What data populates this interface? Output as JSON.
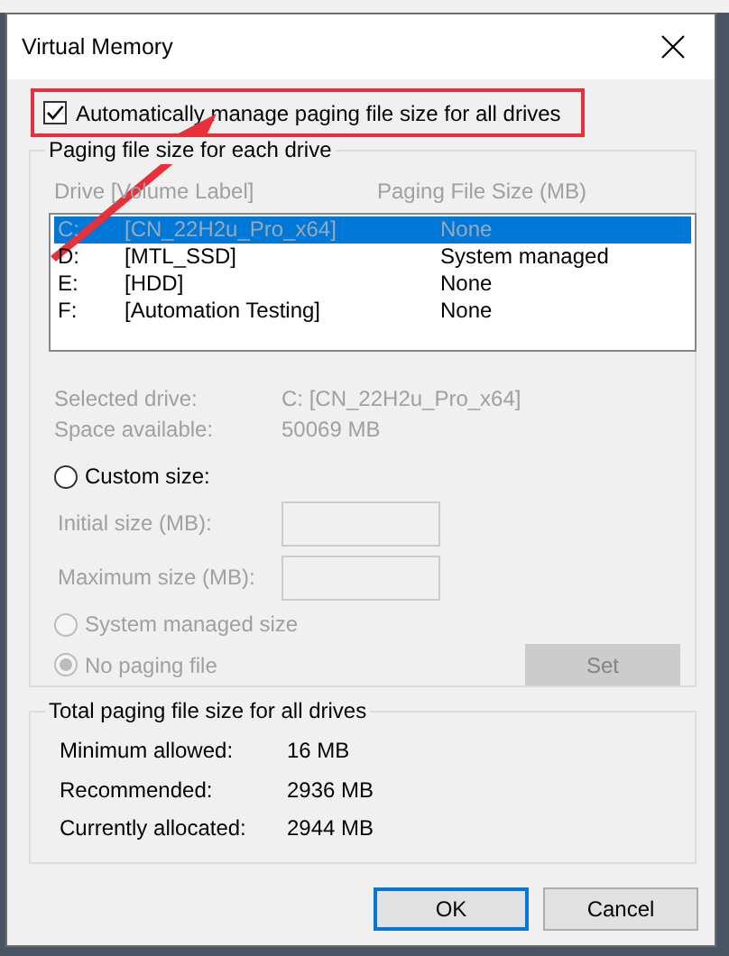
{
  "window": {
    "title": "Virtual Memory"
  },
  "auto_manage": {
    "label": "Automatically manage paging file size for all drives",
    "checked": true
  },
  "drive_group": {
    "legend": "Paging file size for each drive",
    "disabled": true,
    "columns": [
      "Drive  [Volume Label]",
      "Paging File Size (MB)"
    ],
    "drives": [
      {
        "drive": "C:",
        "label": "[CN_22H2u_Pro_x64]",
        "size": "None",
        "selected": true
      },
      {
        "drive": "D:",
        "label": "[MTL_SSD]",
        "size": "System managed",
        "selected": false
      },
      {
        "drive": "E:",
        "label": "[HDD]",
        "size": "None",
        "selected": false
      },
      {
        "drive": "F:",
        "label": "[Automation Testing]",
        "size": "None",
        "selected": false
      }
    ],
    "details": [
      {
        "label": "Selected drive:",
        "value": "C:  [CN_22H2u_Pro_x64]"
      },
      {
        "label": "Space available:",
        "value": "50069 MB"
      }
    ],
    "custom_size": {
      "label": "Custom size:",
      "selected": false,
      "disabled": false
    },
    "size_fields": [
      {
        "label": "Initial size (MB):"
      },
      {
        "label": "Maximum size (MB):"
      }
    ],
    "system_managed": {
      "label": "System managed size",
      "selected": false,
      "disabled": true
    },
    "no_paging": {
      "label": "No paging file",
      "selected": true,
      "disabled": true
    },
    "set_button": {
      "label": "Set",
      "disabled": true
    }
  },
  "totals": {
    "legend": "Total paging file size for all drives",
    "rows": [
      {
        "label": "Minimum allowed:",
        "value": "16 MB"
      },
      {
        "label": "Recommended:",
        "value": "2936 MB"
      },
      {
        "label": "Currently allocated:",
        "value": "2944 MB"
      }
    ]
  },
  "buttons": [
    {
      "label": "OK",
      "default": true
    },
    {
      "label": "Cancel",
      "default": false
    }
  ]
}
